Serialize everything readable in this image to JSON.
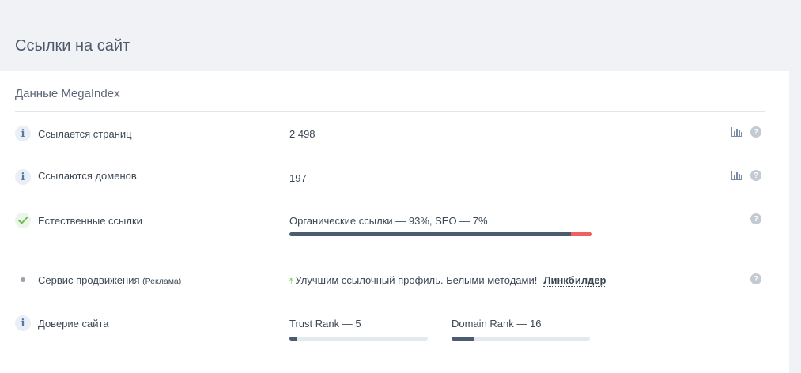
{
  "page": {
    "title": "Ссылки на сайт"
  },
  "card": {
    "title": "Данные MegaIndex",
    "rows": {
      "pages": {
        "label": "Ссылается страниц",
        "value": "2 498"
      },
      "domains": {
        "label": "Ссылаются доменов",
        "value": "197"
      },
      "natural": {
        "label": "Естественные ссылки",
        "value": "Органические ссылки — 93%, SEO — 7%",
        "organic_percent": 93,
        "seo_percent": 7
      },
      "promo": {
        "label": "Сервис продвижения",
        "label_suffix": "(Реклама)",
        "text": "Улучшим ссылочный профиль. Белыми методами!",
        "link": "Линкбилдер"
      },
      "trust": {
        "label": "Доверие сайта",
        "trust_rank_text": "Trust Rank — 5",
        "trust_rank": 5,
        "domain_rank_text": "Domain Rank — 16",
        "domain_rank": 16
      }
    },
    "icons": {
      "info": "i",
      "help": "?"
    }
  },
  "colors": {
    "bar_dark": "#4c5c70",
    "bar_seo": "#f06060",
    "check": "#6cbf4a"
  }
}
